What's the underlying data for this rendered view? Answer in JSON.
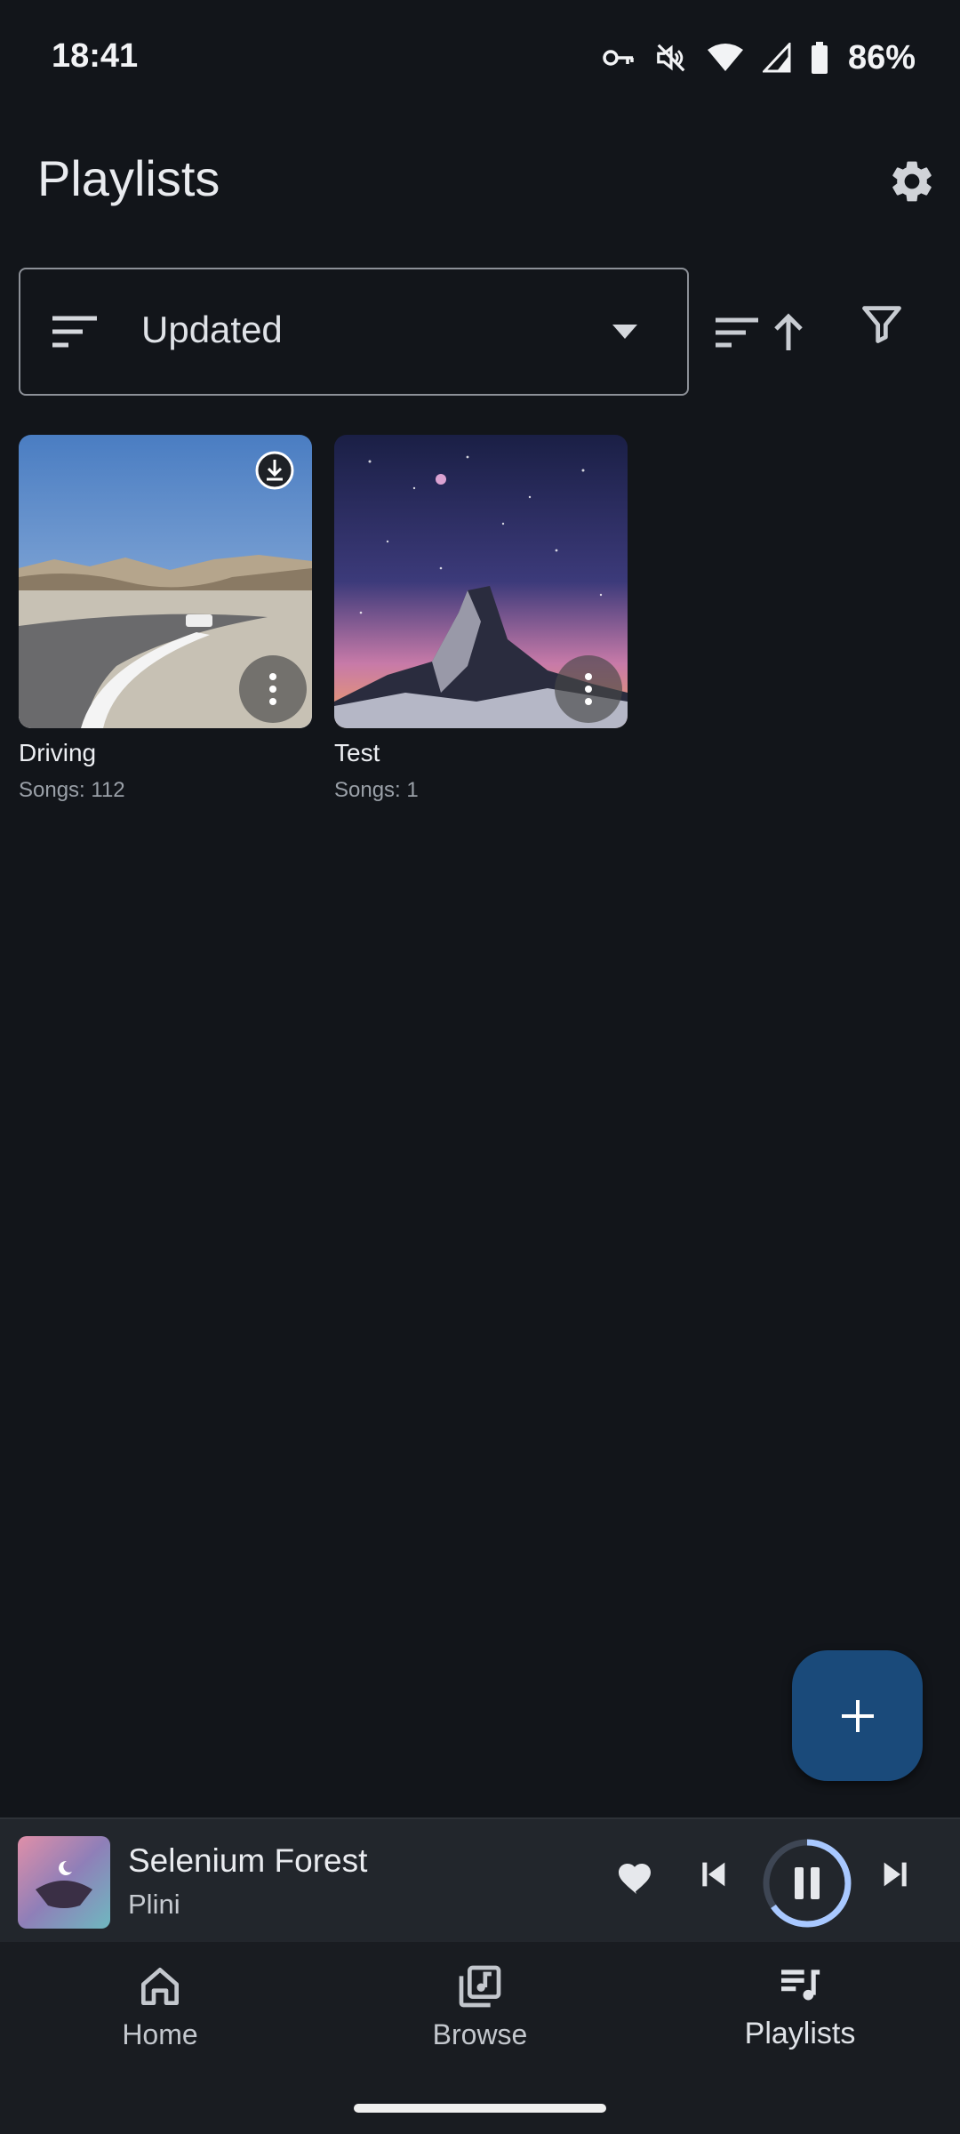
{
  "status_bar": {
    "time": "18:41",
    "battery": "86%"
  },
  "header": {
    "title": "Playlists"
  },
  "sort": {
    "selected": "Updated"
  },
  "playlists": [
    {
      "name": "Driving",
      "songs": "Songs: 112",
      "downloaded": true
    },
    {
      "name": "Test",
      "songs": "Songs: 1",
      "downloaded": false
    }
  ],
  "now_playing": {
    "title": "Selenium Forest",
    "artist": "Plini"
  },
  "nav": {
    "items": [
      {
        "label": "Home",
        "icon": "home-icon"
      },
      {
        "label": "Browse",
        "icon": "library-music-icon"
      },
      {
        "label": "Playlists",
        "icon": "queue-music-icon"
      }
    ],
    "active": "Playlists"
  },
  "colors": {
    "background": "#12151a",
    "fab": "#1a4a7a",
    "accent": "#a8c8ff"
  }
}
